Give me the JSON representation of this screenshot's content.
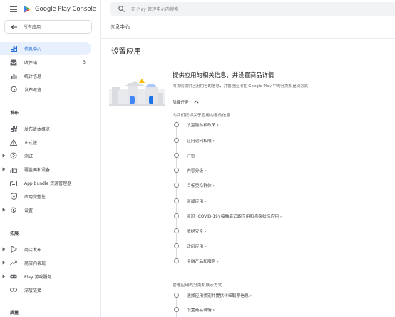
{
  "app": {
    "brand_prefix": "Google Play",
    "brand_suffix": "Console"
  },
  "sidebar": {
    "all_apps": "所有应用",
    "items_main": [
      {
        "label": "信息中心",
        "active": true,
        "icon": "dashboard-icon"
      },
      {
        "label": "收件箱",
        "count": "3",
        "icon": "inbox-icon"
      },
      {
        "label": "统计信息",
        "icon": "bar-chart-icon"
      },
      {
        "label": "发布概览",
        "icon": "history-icon"
      }
    ],
    "release_title": "发布",
    "items_release": [
      {
        "label": "发布版本概览",
        "icon": "grid-icon"
      },
      {
        "label": "正式版",
        "icon": "warning-icon"
      },
      {
        "label": "测试",
        "icon": "test-icon",
        "expandable": true
      },
      {
        "label": "覆盖面和设备",
        "icon": "reach-icon",
        "expandable": true
      },
      {
        "label": "App bundle 资源管理器",
        "icon": "bundle-icon"
      },
      {
        "label": "应用完整性",
        "icon": "shield-icon"
      },
      {
        "label": "设置",
        "icon": "gear-icon",
        "expandable": true
      }
    ],
    "grow_title": "拓展",
    "items_grow": [
      {
        "label": "商店发布",
        "icon": "play-outline-icon",
        "expandable": true
      },
      {
        "label": "商店内表现",
        "icon": "trend-icon",
        "expandable": true
      },
      {
        "label": "Play 游戏服务",
        "icon": "gamepad-icon",
        "expandable": true
      },
      {
        "label": "深层链接",
        "icon": "link-icon"
      }
    ],
    "quality_title": "质量"
  },
  "search": {
    "placeholder": "在 Play 管理中心内搜索"
  },
  "page": {
    "breadcrumb": "信息中心",
    "title": "设置应用"
  },
  "task": {
    "title": "提供应用的相关信息，并设置商品详情",
    "description": "向我们提供应用内容的信息，并管理应用在 Google Play 中的分类和呈现方式",
    "hide_label": "隐藏任务",
    "content_group": "向我们提供关于应用内容的信息",
    "content_steps": [
      "设置隐私权政策",
      "应用访问权限",
      "广告",
      "内容分级",
      "目标受众群体",
      "新闻应用",
      "新冠 (COVID-19) 接触者追踪应用和感染状况应用",
      "数据安全",
      "政府应用",
      "金融产品和服务"
    ],
    "listing_group": "管理应用的分类和展示方式",
    "listing_steps": [
      "选择应用类别并提供详细联系信息",
      "设置商品详情"
    ]
  },
  "colors": {
    "accent": "#1967d2",
    "active_bg": "#e8f0fe"
  }
}
